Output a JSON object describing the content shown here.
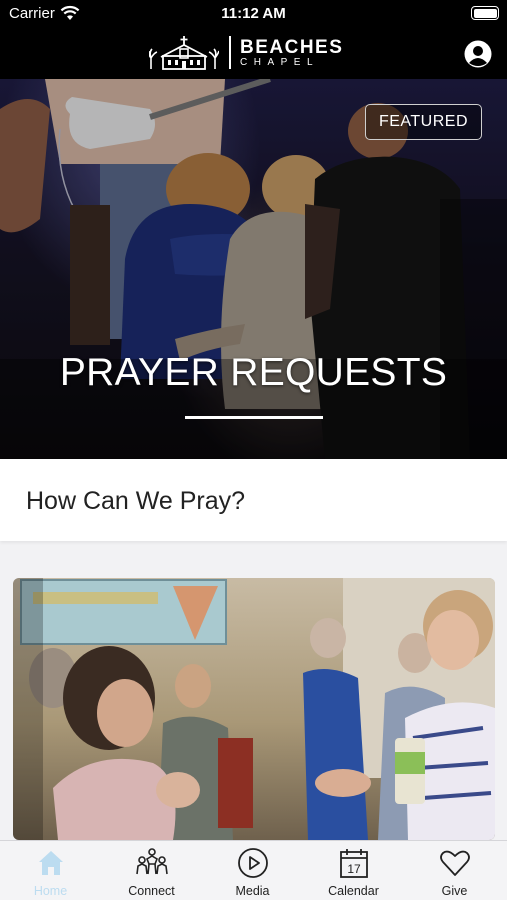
{
  "status_bar": {
    "carrier": "Carrier",
    "time": "11:12 AM"
  },
  "header": {
    "logo_name": "BEACHES",
    "logo_sub": "CHAPEL"
  },
  "hero": {
    "badge": "FEATURED",
    "title": "PRAYER REQUESTS"
  },
  "section": {
    "title": "How Can We Pray?"
  },
  "tabs": [
    {
      "label": "Home",
      "icon": "home-icon",
      "active": true
    },
    {
      "label": "Connect",
      "icon": "people-icon",
      "active": false
    },
    {
      "label": "Media",
      "icon": "play-icon",
      "active": false
    },
    {
      "label": "Calendar",
      "icon": "calendar-icon",
      "active": false
    },
    {
      "label": "Give",
      "icon": "heart-icon",
      "active": false
    }
  ],
  "calendar_icon_day": "17",
  "colors": {
    "active_tab": "#bcdcf0",
    "header_bg": "#000000"
  }
}
